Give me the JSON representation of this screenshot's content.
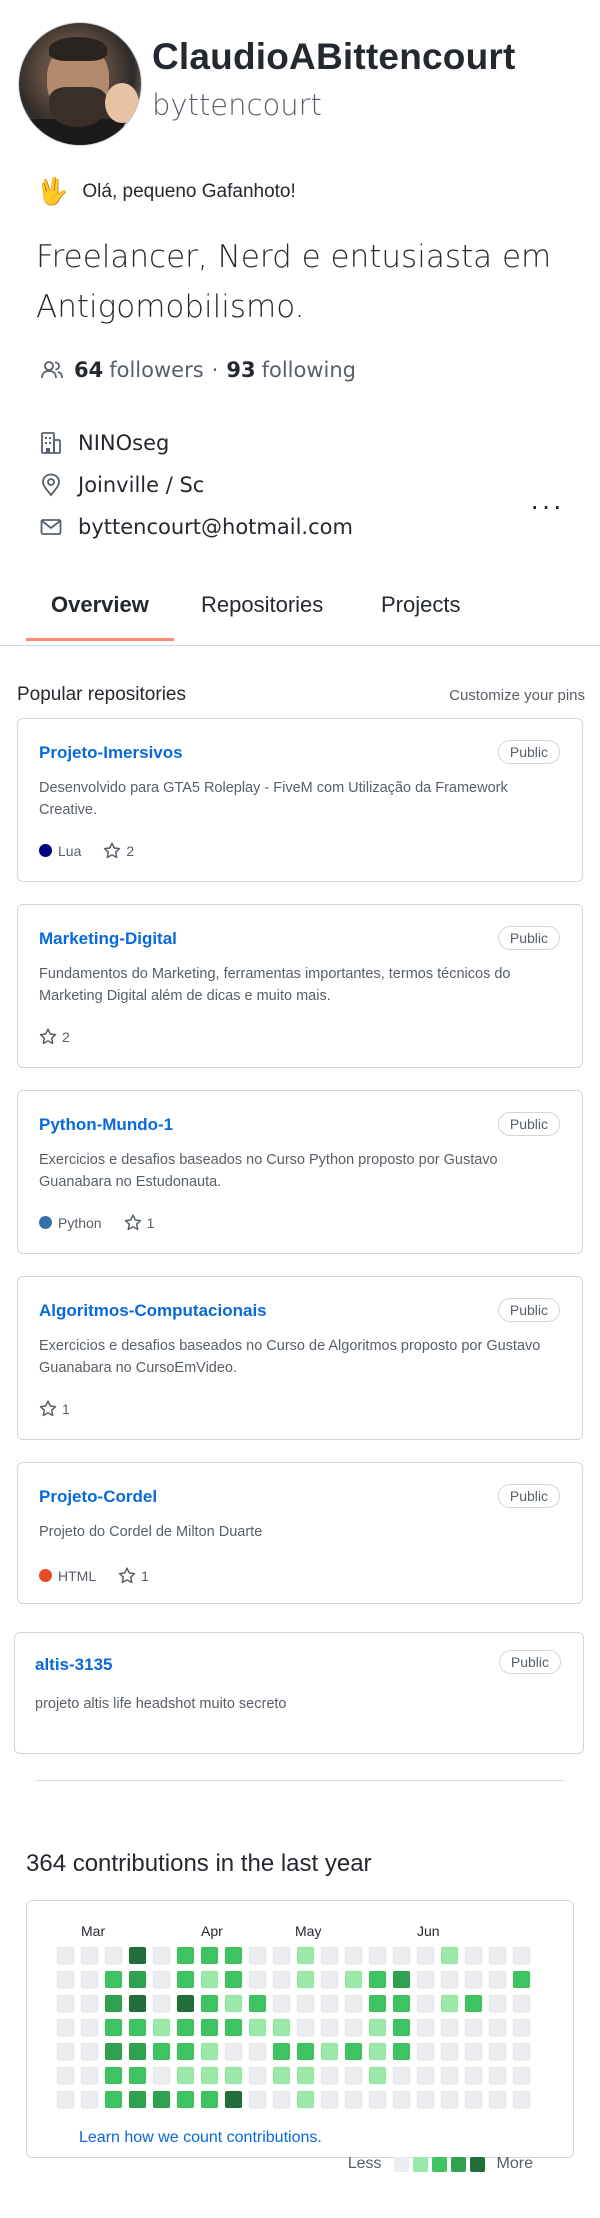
{
  "profile": {
    "name": "ClaudioABittencourt",
    "login": "byttencourt",
    "status_emoji": "🖖",
    "status_text": "Olá, pequeno Gafanhoto!",
    "bio": "Freelancer, Nerd e entusiasta em Antigomobilismo.",
    "followers_count": "64",
    "followers_label": "followers",
    "following_count": "93",
    "following_label": "following",
    "company": "NINOseg",
    "location": "Joinville / Sc",
    "email": "byttencourt@hotmail.com",
    "more_label": "···"
  },
  "tabs": [
    {
      "label": "Overview",
      "active": true
    },
    {
      "label": "Repositories",
      "active": false
    },
    {
      "label": "Projects",
      "active": false
    }
  ],
  "pinned": {
    "title": "Popular repositories",
    "customize_label": "Customize your pins",
    "repos": [
      {
        "name": "Projeto-Imersivos",
        "visibility": "Public",
        "description": "Desenvolvido para GTA5 Roleplay - FiveM com Utilização da Framework Creative.",
        "language": "Lua",
        "language_color": "#000080",
        "stars": "2"
      },
      {
        "name": "Marketing-Digital",
        "visibility": "Public",
        "description": "Fundamentos do Marketing, ferramentas importantes, termos técnicos do Marketing Digital além de dicas e muito mais.",
        "language": "",
        "language_color": "",
        "stars": "2"
      },
      {
        "name": "Python-Mundo-1",
        "visibility": "Public",
        "description": "Exercicios e desafios baseados no Curso Python proposto por Gustavo Guanabara no Estudonauta.",
        "language": "Python",
        "language_color": "#3572A5",
        "stars": "1"
      },
      {
        "name": "Algoritmos-Computacionais",
        "visibility": "Public",
        "description": "Exercicios e desafios baseados no Curso de Algoritmos proposto por Gustavo Guanabara no CursoEmVideo.",
        "language": "",
        "language_color": "",
        "stars": "1"
      },
      {
        "name": "Projeto-Cordel",
        "visibility": "Public",
        "description": "Projeto do Cordel de Milton Duarte",
        "language": "HTML",
        "language_color": "#e34c26",
        "stars": "1"
      },
      {
        "name": "altis-3135",
        "visibility": "Public",
        "description": "projeto altis life headshot muito secreto",
        "language": "",
        "language_color": "",
        "stars": ""
      }
    ]
  },
  "contributions": {
    "title": "364 contributions in the last year",
    "months": [
      "Mar",
      "Apr",
      "May",
      "Jun"
    ],
    "learn_link": "Learn how we count contributions.",
    "legend_less": "Less",
    "legend_more": "More",
    "colors": [
      "#ebedf0",
      "#9be9a8",
      "#40c463",
      "#30a14e",
      "#216e39"
    ],
    "weeks": [
      [
        0,
        0,
        0,
        0,
        0,
        0,
        0
      ],
      [
        0,
        0,
        0,
        0,
        0,
        0,
        0
      ],
      [
        0,
        2,
        3,
        2,
        3,
        2,
        2
      ],
      [
        4,
        3,
        4,
        2,
        3,
        2,
        3
      ],
      [
        0,
        0,
        0,
        1,
        2,
        0,
        3
      ],
      [
        2,
        2,
        4,
        2,
        2,
        1,
        2
      ],
      [
        2,
        1,
        2,
        2,
        1,
        1,
        2
      ],
      [
        2,
        2,
        1,
        2,
        0,
        1,
        4
      ],
      [
        0,
        0,
        2,
        1,
        0,
        0,
        0
      ],
      [
        0,
        0,
        0,
        1,
        2,
        1,
        0
      ],
      [
        1,
        1,
        0,
        0,
        2,
        1,
        1
      ],
      [
        0,
        0,
        0,
        0,
        1,
        0,
        0
      ],
      [
        0,
        1,
        0,
        0,
        2,
        0,
        0
      ],
      [
        0,
        2,
        2,
        1,
        1,
        1,
        0
      ],
      [
        0,
        3,
        2,
        2,
        2,
        0,
        0
      ],
      [
        0,
        0,
        0,
        0,
        0,
        0,
        0
      ],
      [
        1,
        0,
        1,
        0,
        0,
        0,
        0
      ],
      [
        0,
        0,
        2,
        0,
        0,
        0,
        0
      ],
      [
        0,
        0,
        0,
        0,
        0,
        0,
        0
      ],
      [
        0,
        2,
        0,
        0,
        0,
        0,
        0
      ]
    ]
  }
}
